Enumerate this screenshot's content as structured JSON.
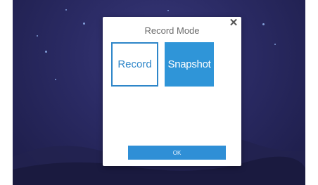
{
  "dialog": {
    "title": "Record Mode",
    "close_glyph": "✕",
    "options": [
      {
        "label": "Record",
        "selected": false
      },
      {
        "label": "Snapshot",
        "selected": true
      }
    ],
    "ok_label": "OK"
  },
  "colors": {
    "accent": "#2f95d8",
    "background": "#2a2a63",
    "dialog_bg": "#ffffff"
  },
  "icons": {
    "close": "close-icon"
  }
}
